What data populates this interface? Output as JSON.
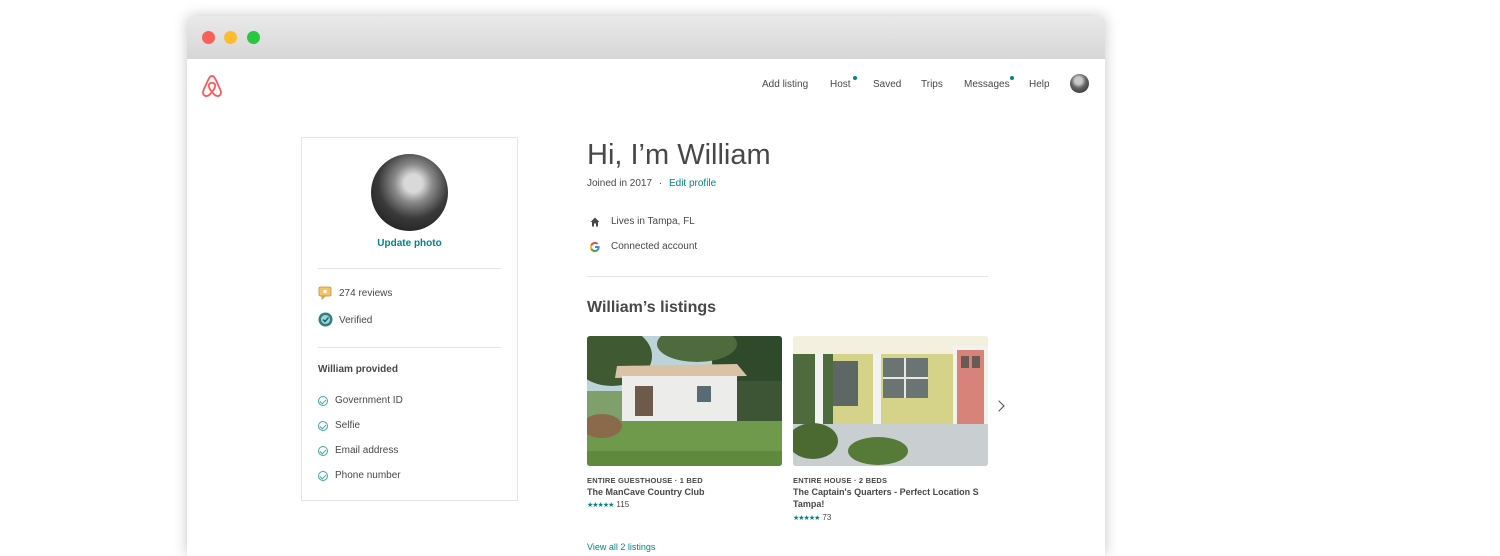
{
  "window": {
    "controls": [
      "close",
      "minimize",
      "maximize"
    ]
  },
  "brand": {
    "logo_icon": "airbnb-logo-icon",
    "color": "#ff5a5f"
  },
  "nav": {
    "items": [
      {
        "label": "Add listing",
        "badge": false
      },
      {
        "label": "Host",
        "badge": true
      },
      {
        "label": "Saved",
        "badge": false
      },
      {
        "label": "Trips",
        "badge": false
      },
      {
        "label": "Messages",
        "badge": true
      },
      {
        "label": "Help",
        "badge": false
      }
    ],
    "badge_color": "#008489"
  },
  "profile_card": {
    "update_photo": "Update photo",
    "reviews": "274 reviews",
    "verified": "Verified",
    "provided_title": "William provided",
    "provided_items": [
      "Government ID",
      "Selfie",
      "Email address",
      "Phone number"
    ]
  },
  "profile": {
    "heading": "Hi, I’m William",
    "joined": "Joined in 2017",
    "separator": "·",
    "edit_profile": "Edit profile",
    "lives_in": "Lives in Tampa, FL",
    "connected": "Connected account"
  },
  "listings": {
    "title": "William’s listings",
    "items": [
      {
        "type": "ENTIRE GUESTHOUSE · 1 BED",
        "title": "The ManCave Country Club",
        "stars": "★★★★★",
        "count": "115",
        "rating": 5
      },
      {
        "type": "ENTIRE HOUSE · 2 BEDS",
        "title": "The Captain's Quarters - Perfect Location S Tampa!",
        "stars": "★★★★★",
        "count": "73",
        "rating": 4.5
      }
    ],
    "view_all": "View all 2 listings"
  },
  "colors": {
    "accent": "#008489",
    "text": "#484848",
    "brand": "#ff5a5f"
  }
}
